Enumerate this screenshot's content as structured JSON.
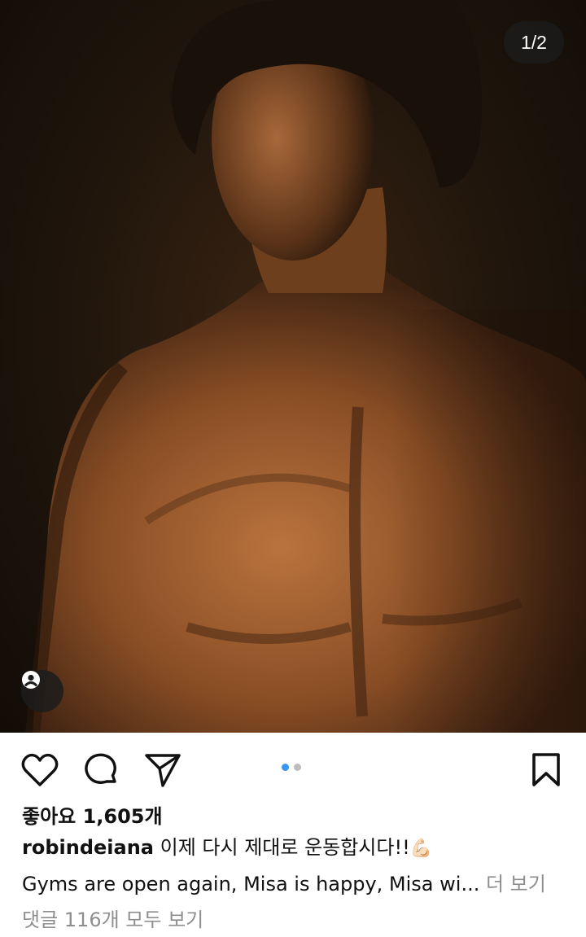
{
  "post": {
    "image_counter": "1/2",
    "carousel": {
      "total": 2,
      "active_index": 0
    },
    "likes_text": "좋아요 1,605개",
    "username": "robindeiana",
    "caption_line1": "이제 다시 제대로 운동합시다!!",
    "caption_emoji": "💪🏻",
    "caption_line2": "Gyms are open again, Misa is happy, Misa wi...",
    "more_label": "더 보기",
    "comments_link": "댓글 116개 모두 보기"
  },
  "icons": {
    "like": "heart-icon",
    "comment": "comment-bubble-icon",
    "share": "paper-plane-icon",
    "bookmark": "bookmark-icon",
    "tag": "person-tag-icon"
  },
  "colors": {
    "accent": "#3897f0",
    "muted_text": "#8e8e8e",
    "text": "#111111"
  }
}
